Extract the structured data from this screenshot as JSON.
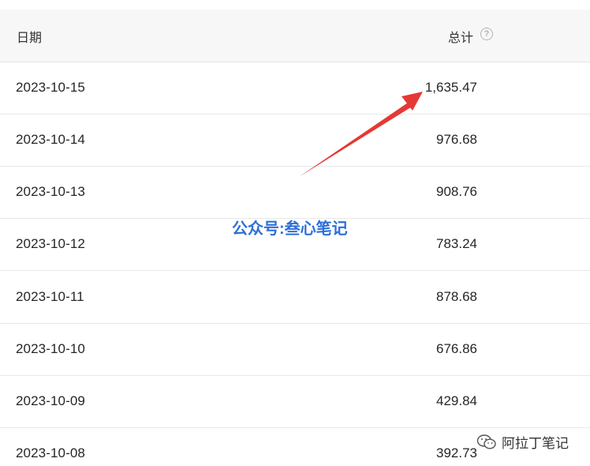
{
  "header": {
    "date_label": "日期",
    "total_label": "总计",
    "help_icon": "?"
  },
  "rows": [
    {
      "date": "2023-10-15",
      "total": "1,635.47"
    },
    {
      "date": "2023-10-14",
      "total": "976.68"
    },
    {
      "date": "2023-10-13",
      "total": "908.76"
    },
    {
      "date": "2023-10-12",
      "total": "783.24"
    },
    {
      "date": "2023-10-11",
      "total": "878.68"
    },
    {
      "date": "2023-10-10",
      "total": "676.86"
    },
    {
      "date": "2023-10-09",
      "total": "429.84"
    },
    {
      "date": "2023-10-08",
      "total": "392.73"
    }
  ],
  "watermark": "公众号:叁心笔记",
  "footer_mark": "阿拉丁笔记",
  "colors": {
    "arrow": "#e53935",
    "watermark": "#2f6fd6",
    "header_bg": "#f7f7f7"
  },
  "icons": {
    "help": "question-circle-icon",
    "footer": "wechat-icon",
    "annotation": "red-arrow-icon"
  }
}
